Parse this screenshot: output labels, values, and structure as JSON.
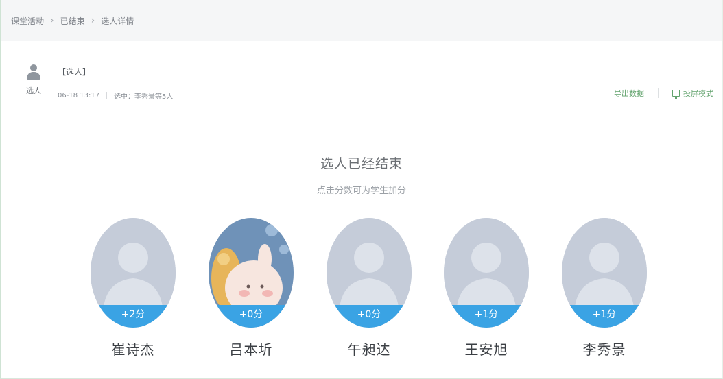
{
  "breadcrumb": [
    "课堂活动",
    "已结束",
    "选人详情"
  ],
  "activity": {
    "icon": "user-icon",
    "type_caption": "选人",
    "title": "【选人】",
    "time": "06-18 13:17",
    "note": "选中：李秀景等5人"
  },
  "actions": {
    "export_label": "导出数据",
    "screen_label": "投屏模式",
    "accent_color": "#62a36d"
  },
  "summary": {
    "title": "选人已经结束",
    "hint": "点击分数可为学生加分"
  },
  "students": [
    {
      "name": "崔诗杰",
      "score": "+2分",
      "avatar": "default-avatar"
    },
    {
      "name": "吕本圻",
      "score": "+0分",
      "avatar": "cartoon-avatar"
    },
    {
      "name": "午昶达",
      "score": "+0分",
      "avatar": "default-avatar"
    },
    {
      "name": "王安旭",
      "score": "+1分",
      "avatar": "default-avatar"
    },
    {
      "name": "李秀景",
      "score": "+1分",
      "avatar": "default-avatar"
    }
  ],
  "colors": {
    "score_bar": "#3aa3e4",
    "avatar_bg": "#c7ceda"
  }
}
